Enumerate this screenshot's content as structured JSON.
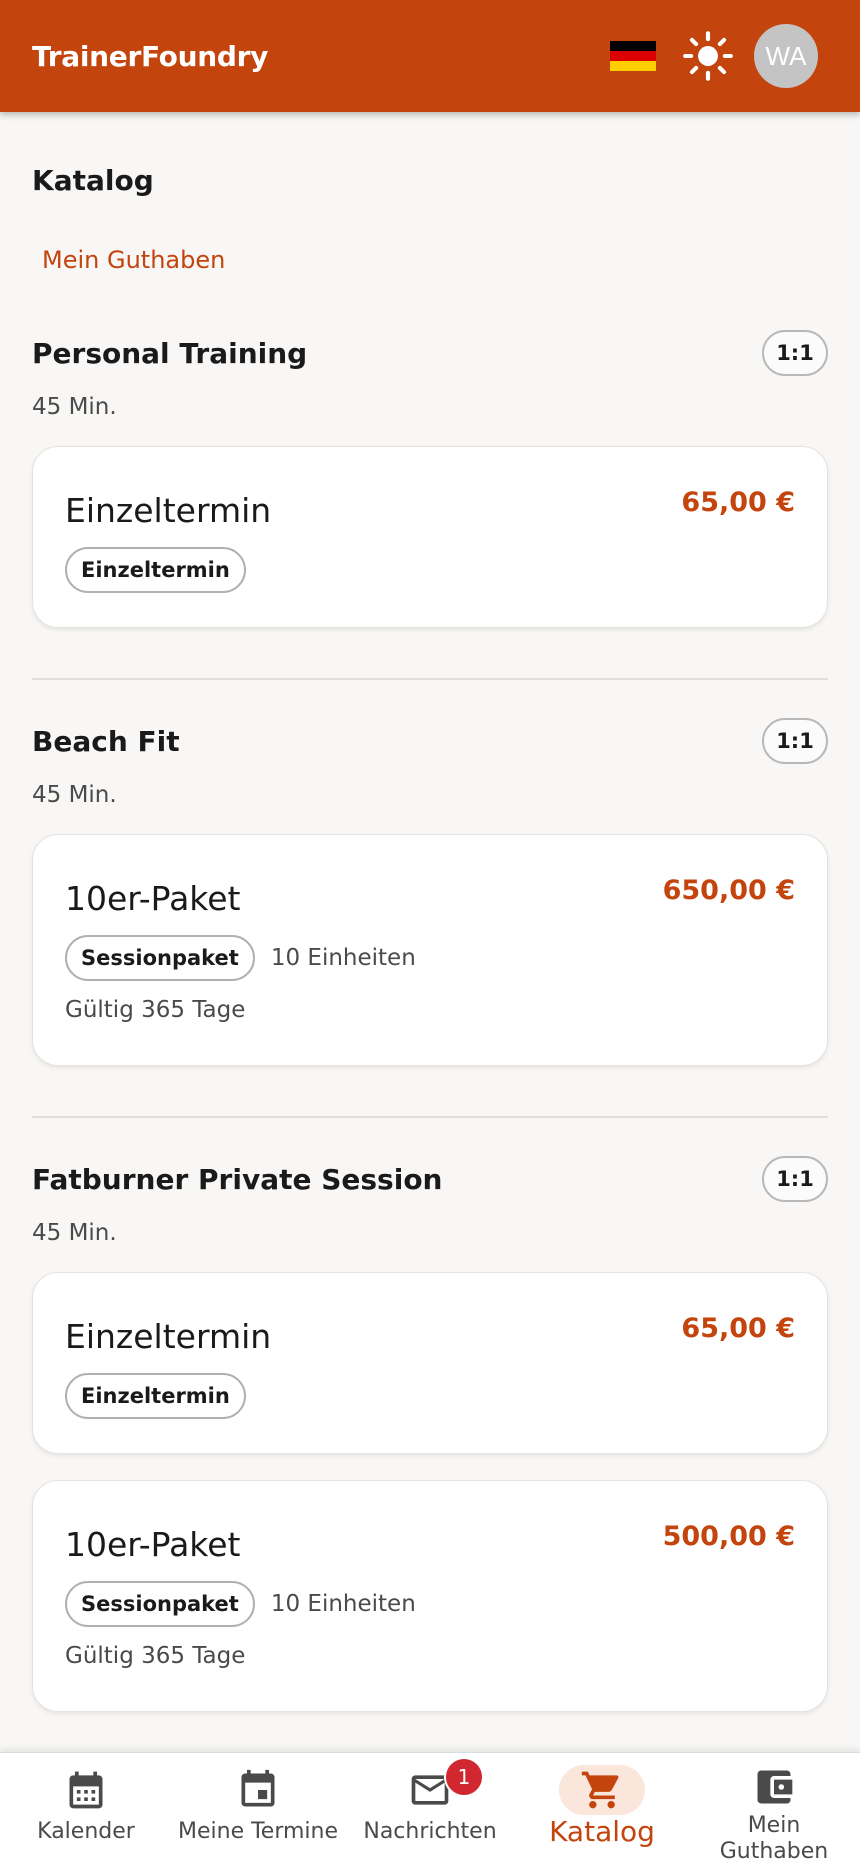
{
  "app": {
    "title": "TrainerFoundry",
    "avatar_initials": "WA"
  },
  "colors": {
    "primary": "#c4440e",
    "badge": "#d0282e"
  },
  "icons": {
    "language": "german-flag-icon",
    "theme": "sun-icon",
    "nav": [
      "calendar-icon",
      "event-icon",
      "mail-icon",
      "cart-icon",
      "wallet-icon"
    ]
  },
  "page": {
    "title": "Katalog",
    "credit_link": "Mein Guthaben"
  },
  "services": [
    {
      "name": "Personal Training",
      "ratio": "1:1",
      "duration": "45 Min.",
      "offers": [
        {
          "title": "Einzeltermin",
          "price": "65,00 €",
          "tag": "Einzeltermin"
        }
      ]
    },
    {
      "name": "Beach Fit",
      "ratio": "1:1",
      "duration": "45 Min.",
      "offers": [
        {
          "title": "10er-Paket",
          "price": "650,00 €",
          "tag": "Sessionpaket",
          "units": "10 Einheiten",
          "validity": "Gültig 365 Tage"
        }
      ]
    },
    {
      "name": "Fatburner Private Session",
      "ratio": "1:1",
      "duration": "45 Min.",
      "offers": [
        {
          "title": "Einzeltermin",
          "price": "65,00 €",
          "tag": "Einzeltermin"
        },
        {
          "title": "10er-Paket",
          "price": "500,00 €",
          "tag": "Sessionpaket",
          "units": "10 Einheiten",
          "validity": "Gültig 365 Tage"
        }
      ]
    }
  ],
  "nav": {
    "items": [
      {
        "label": "Kalender"
      },
      {
        "label": "Meine Termine"
      },
      {
        "label": "Nachrichten",
        "badge": "1"
      },
      {
        "label": "Katalog",
        "active": true
      },
      {
        "label": "Mein Guthaben"
      }
    ]
  }
}
